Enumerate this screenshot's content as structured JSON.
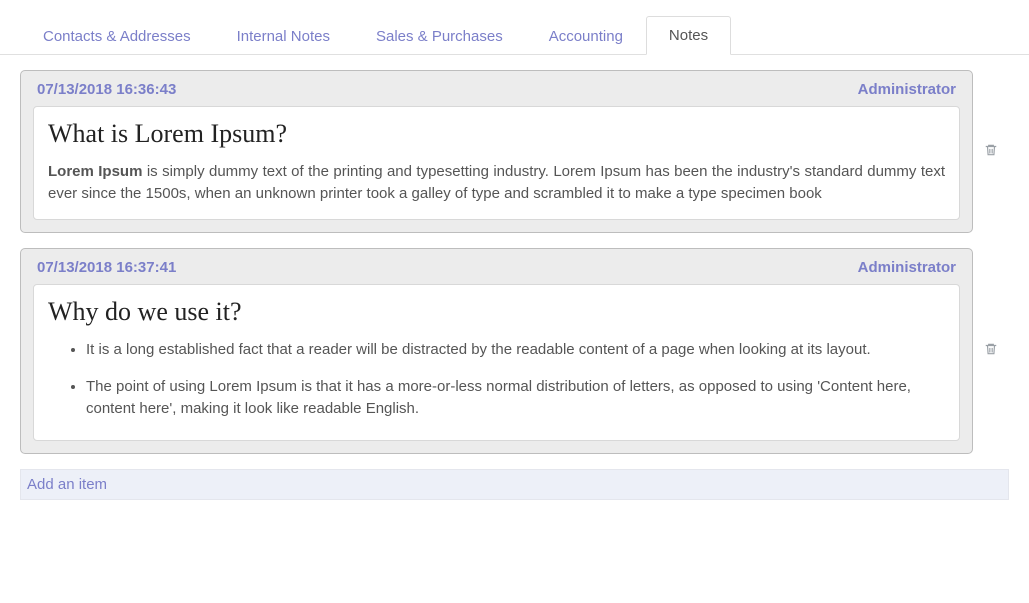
{
  "tabs": [
    {
      "label": "Contacts & Addresses",
      "active": false
    },
    {
      "label": "Internal Notes",
      "active": false
    },
    {
      "label": "Sales & Purchases",
      "active": false
    },
    {
      "label": "Accounting",
      "active": false
    },
    {
      "label": "Notes",
      "active": true
    }
  ],
  "notes": [
    {
      "timestamp": "07/13/2018 16:36:43",
      "author": "Administrator",
      "title": "What is Lorem Ipsum?",
      "body_strong": "Lorem Ipsum",
      "body_rest": " is simply dummy text of the printing and typesetting industry. Lorem Ipsum has been the industry's standard dummy text ever since the 1500s, when an unknown printer took a galley of type and scrambled it to make a type specimen book"
    },
    {
      "timestamp": "07/13/2018 16:37:41",
      "author": "Administrator",
      "title": "Why do we use it?",
      "bullets": [
        "It is a long established fact that a reader will be distracted by the readable content of a page when looking at its layout.",
        "The point of using Lorem Ipsum is that it has a more-or-less normal distribution of letters, as opposed to using 'Content here, content here', making it look like readable English."
      ]
    }
  ],
  "add_item_label": "Add an item"
}
